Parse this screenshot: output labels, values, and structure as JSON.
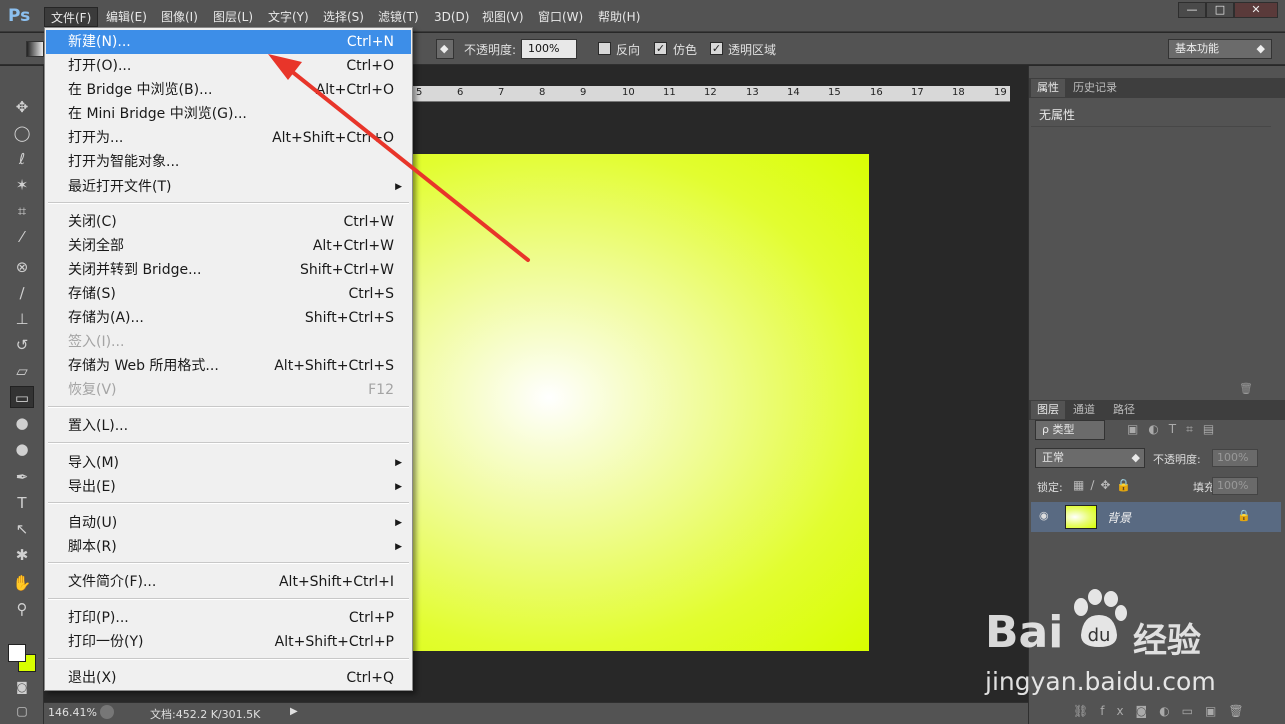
{
  "app": {
    "logo": "Ps"
  },
  "menubar": {
    "items": [
      "文件(F)",
      "编辑(E)",
      "图像(I)",
      "图层(L)",
      "文字(Y)",
      "选择(S)",
      "滤镜(T)",
      "3D(D)",
      "视图(V)",
      "窗口(W)",
      "帮助(H)"
    ],
    "window_min": "—",
    "window_max": "□",
    "window_close": "✕"
  },
  "options": {
    "opacity_label": "不透明度:",
    "opacity_value": "100%",
    "reverse": "反向",
    "dither": "仿色",
    "transparency": "透明区域",
    "workspace": "基本功能"
  },
  "ruler": {
    "ticks": [
      "5",
      "6",
      "7",
      "8",
      "9",
      "10",
      "11",
      "12",
      "13",
      "14",
      "15",
      "16",
      "17",
      "18",
      "19"
    ]
  },
  "status": {
    "zoom": "146.41%",
    "doc": "文档:452.2 K/301.5K"
  },
  "properties_panel": {
    "tabs": [
      "属性",
      "历史记录"
    ],
    "content": "无属性"
  },
  "layers_panel": {
    "tabs": [
      "图层",
      "通道",
      "路径"
    ],
    "filter": "ρ 类型",
    "blend_mode": "正常",
    "opacity_label": "不透明度:",
    "opacity_value": "100%",
    "lock_label": "锁定:",
    "fill_label": "填充:",
    "fill_value": "100%",
    "layer_name": "背景"
  },
  "file_menu": {
    "items": [
      {
        "label": "新建(N)...",
        "shortcut": "Ctrl+N",
        "highlighted": true
      },
      {
        "label": "打开(O)...",
        "shortcut": "Ctrl+O"
      },
      {
        "label": "在 Bridge 中浏览(B)...",
        "shortcut": "Alt+Ctrl+O"
      },
      {
        "label": "在 Mini Bridge 中浏览(G)...",
        "shortcut": ""
      },
      {
        "label": "打开为...",
        "shortcut": "Alt+Shift+Ctrl+O"
      },
      {
        "label": "打开为智能对象...",
        "shortcut": ""
      },
      {
        "label": "最近打开文件(T)",
        "shortcut": "",
        "submenu": true
      },
      {
        "label": "关闭(C)",
        "shortcut": "Ctrl+W"
      },
      {
        "label": "关闭全部",
        "shortcut": "Alt+Ctrl+W"
      },
      {
        "label": "关闭并转到 Bridge...",
        "shortcut": "Shift+Ctrl+W"
      },
      {
        "label": "存储(S)",
        "shortcut": "Ctrl+S"
      },
      {
        "label": "存储为(A)...",
        "shortcut": "Shift+Ctrl+S"
      },
      {
        "label": "签入(I)...",
        "shortcut": "",
        "disabled": true
      },
      {
        "label": "存储为 Web 所用格式...",
        "shortcut": "Alt+Shift+Ctrl+S"
      },
      {
        "label": "恢复(V)",
        "shortcut": "F12",
        "disabled": true
      },
      {
        "label": "置入(L)...",
        "shortcut": ""
      },
      {
        "label": "导入(M)",
        "shortcut": "",
        "submenu": true
      },
      {
        "label": "导出(E)",
        "shortcut": "",
        "submenu": true
      },
      {
        "label": "自动(U)",
        "shortcut": "",
        "submenu": true
      },
      {
        "label": "脚本(R)",
        "shortcut": "",
        "submenu": true
      },
      {
        "label": "文件简介(F)...",
        "shortcut": "Alt+Shift+Ctrl+I"
      },
      {
        "label": "打印(P)...",
        "shortcut": "Ctrl+P"
      },
      {
        "label": "打印一份(Y)",
        "shortcut": "Alt+Shift+Ctrl+P"
      },
      {
        "label": "退出(X)",
        "shortcut": "Ctrl+Q"
      }
    ]
  },
  "watermark": {
    "brand_left": "Bai",
    "brand_right": "经验",
    "url": "jingyan.baidu.com"
  },
  "colors": {
    "highlight": "#3d8ee8",
    "arrow": "#e8352a",
    "canvas_fill": "#d8fe00"
  }
}
